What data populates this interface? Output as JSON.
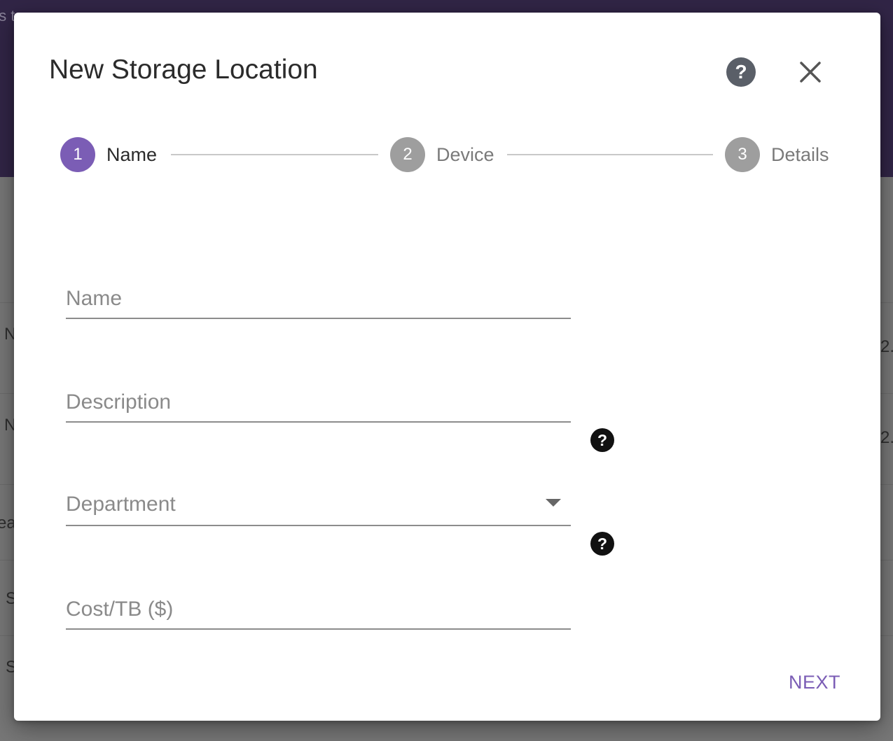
{
  "background": {
    "header_fragment": "es t",
    "row_fragments": [
      "N",
      "N",
      "ea",
      "n S",
      "n S"
    ],
    "right_fragments": [
      "2.",
      "2."
    ]
  },
  "dialog": {
    "title": "New Storage Location",
    "stepper": [
      {
        "number": "1",
        "label": "Name",
        "state": "active"
      },
      {
        "number": "2",
        "label": "Device",
        "state": "inactive"
      },
      {
        "number": "3",
        "label": "Details",
        "state": "inactive"
      }
    ],
    "fields": {
      "name_placeholder": "Name",
      "description_placeholder": "Description",
      "department_label": "Department",
      "cost_placeholder": "Cost/TB ($)"
    },
    "next_label": "NEXT"
  },
  "colors": {
    "accent": "#7b5db5",
    "inactive_step": "#9e9e9e",
    "header": "#312546"
  },
  "icons": {
    "help": "help-circle-icon",
    "close": "close-icon",
    "dropdown": "caret-down-icon",
    "field_help": "help-circle-icon"
  }
}
